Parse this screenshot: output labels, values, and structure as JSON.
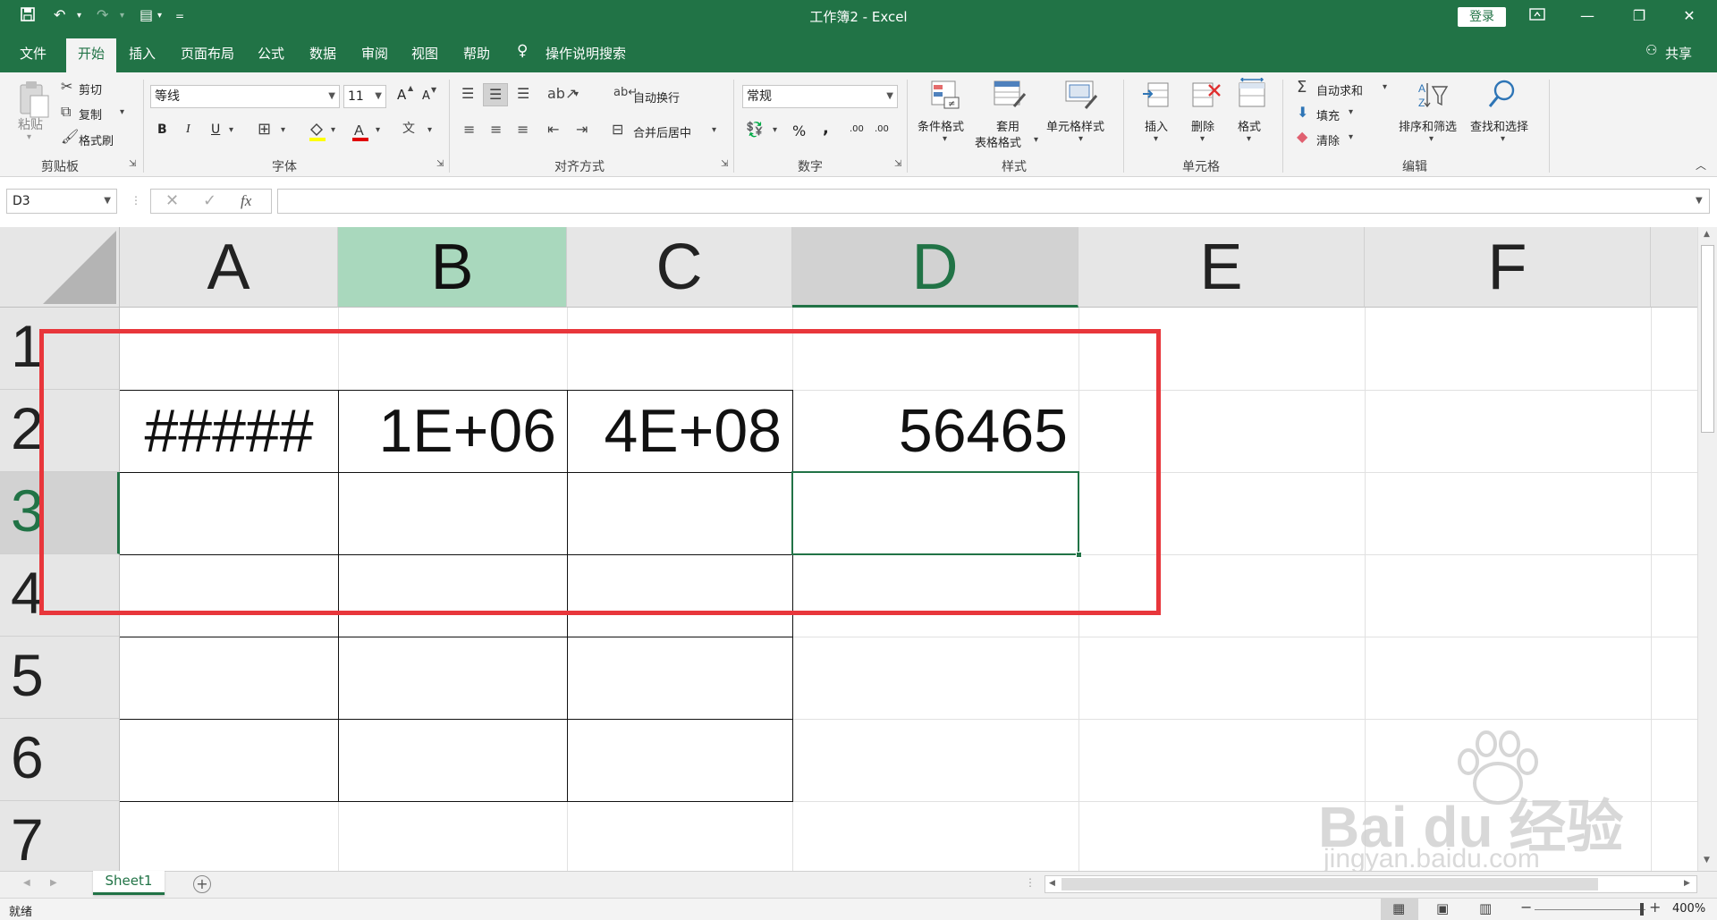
{
  "titlebar": {
    "title": "工作簿2  -  Excel",
    "login": "登录",
    "qat_customize": "="
  },
  "tabs": [
    "文件",
    "开始",
    "插入",
    "页面布局",
    "公式",
    "数据",
    "审阅",
    "视图",
    "帮助"
  ],
  "tell_me": "操作说明搜索",
  "share": "共享",
  "ribbon": {
    "clipboard": {
      "paste": "粘贴",
      "cut": "剪切",
      "copy": "复制",
      "format_painter": "格式刷",
      "label": "剪贴板"
    },
    "font": {
      "name": "等线",
      "size": "11",
      "label": "字体",
      "bold": "B",
      "italic": "I",
      "underline": "U",
      "grow": "A",
      "shrink": "A"
    },
    "alignment": {
      "wrap": "自动换行",
      "merge": "合并后居中",
      "label": "对齐方式"
    },
    "number": {
      "format": "常规",
      "percent": "%",
      "comma": ",",
      "inc_decimal": ".00",
      "dec_decimal": ".00",
      "label": "数字"
    },
    "styles": {
      "conditional": "条件格式",
      "table_line1": "套用",
      "table_line2": "表格格式",
      "cell_styles": "单元格样式",
      "label": "样式"
    },
    "cells": {
      "insert": "插入",
      "delete": "删除",
      "format": "格式",
      "label": "单元格"
    },
    "editing": {
      "autosum": "自动求和",
      "fill": "填充",
      "clear": "清除",
      "sort": "排序和筛选",
      "find": "查找和选择",
      "label": "编辑"
    }
  },
  "formula_bar": {
    "name_box": "D3",
    "fx": "fx",
    "formula": ""
  },
  "grid": {
    "columns": [
      "A",
      "B",
      "C",
      "D",
      "E",
      "F"
    ],
    "rows": [
      "1",
      "2",
      "3",
      "4",
      "5",
      "6",
      "7"
    ],
    "cells": {
      "A2": "#####",
      "B2": "1E+06",
      "C2": "4E+08",
      "D2": "56465"
    },
    "active_cell": "D3"
  },
  "sheet_tabs": [
    "Sheet1"
  ],
  "status": {
    "ready": "就绪",
    "zoom": "400%"
  },
  "watermark": {
    "brand": "Bai du 经验",
    "url": "jingyan.baidu.com"
  },
  "colors": {
    "excel_green": "#217346",
    "highlight": "#e8363b",
    "selected_header": "#a9d8bd"
  }
}
